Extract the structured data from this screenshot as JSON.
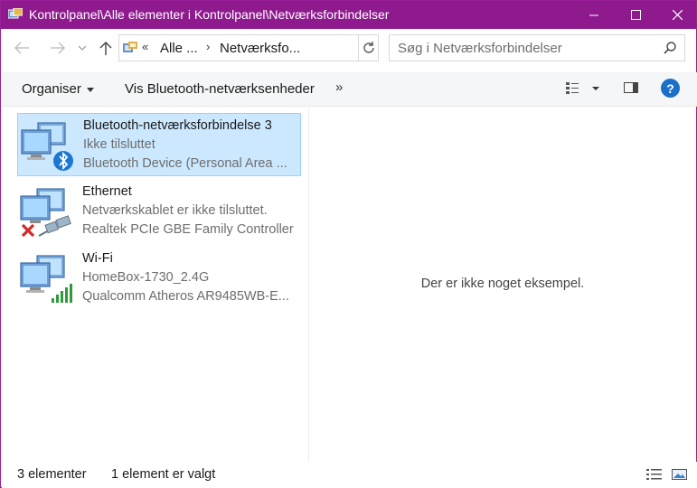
{
  "window": {
    "title": "Kontrolpanel\\Alle elementer i Kontrolpanel\\Netværksforbindelser",
    "accent_color": "#8e1a8e"
  },
  "address": {
    "overflow": "«",
    "segments": [
      "Alle ...",
      "Netværksfo..."
    ]
  },
  "search": {
    "placeholder": "Søg i Netværksforbindelser"
  },
  "commandbar": {
    "organize": "Organiser",
    "bluetooth": "Vis Bluetooth-netværksenheder",
    "more": "»"
  },
  "connections": [
    {
      "name": "Bluetooth-netværksforbindelse 3",
      "status": "Ikke tilsluttet",
      "device": "Bluetooth Device (Personal Area ...",
      "icon": "bluetooth-network-icon",
      "selected": true
    },
    {
      "name": "Ethernet",
      "status": "Netværkskablet er ikke tilsluttet.",
      "device": "Realtek PCIe GBE Family Controller",
      "icon": "ethernet-network-icon",
      "selected": false
    },
    {
      "name": "Wi-Fi",
      "status": "HomeBox-1730_2.4G",
      "device": "Qualcomm Atheros AR9485WB-E...",
      "icon": "wifi-network-icon",
      "selected": false
    }
  ],
  "preview": {
    "message": "Der er ikke noget eksempel."
  },
  "status": {
    "count": "3 elementer",
    "selected": "1 element er valgt"
  }
}
